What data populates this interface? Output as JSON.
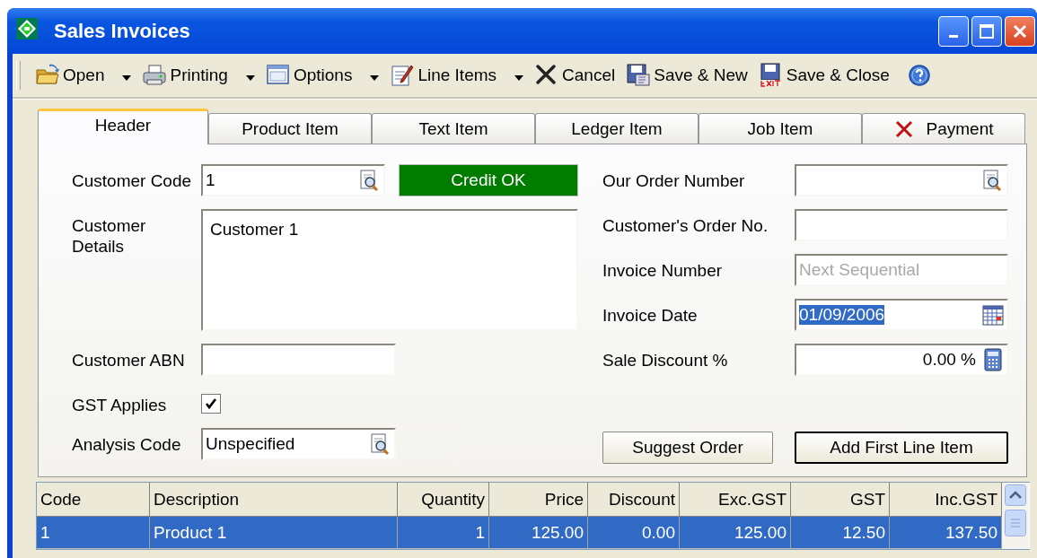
{
  "window": {
    "title": "Sales Invoices"
  },
  "toolbar": [
    {
      "label": "Open",
      "kind": "dropdown"
    },
    {
      "label": "Printing",
      "kind": "dropdown"
    },
    {
      "label": "Options",
      "kind": "dropdown"
    },
    {
      "label": "Line Items",
      "kind": "dropdown"
    },
    {
      "label": "Cancel",
      "kind": "button"
    },
    {
      "label": "Save & New",
      "kind": "button"
    },
    {
      "label": "Save & Close",
      "kind": "button"
    }
  ],
  "tabs": [
    {
      "label": "Header",
      "selected": true
    },
    {
      "label": "Product Item",
      "selected": false
    },
    {
      "label": "Text Item",
      "selected": false
    },
    {
      "label": "Ledger Item",
      "selected": false
    },
    {
      "label": "Job Item",
      "selected": false
    },
    {
      "label": "Payment",
      "selected": false
    }
  ],
  "credit_status": {
    "text": "Credit OK",
    "ok": true
  },
  "left_fields": [
    {
      "label": "Customer Code",
      "kind": "lookup",
      "value": "1"
    },
    {
      "label": "Customer Details",
      "kind": "textarea",
      "value": "Customer 1"
    },
    {
      "label": "Customer ABN",
      "kind": "text"
    },
    {
      "label": "GST Applies",
      "kind": "checkbox",
      "checked": true
    },
    {
      "label": "Analysis Code",
      "kind": "lookup",
      "value": "Unspecified"
    }
  ],
  "right_fields": [
    {
      "label": "Our Order Number",
      "kind": "lookup"
    },
    {
      "label": "Customer's Order No.",
      "kind": "text"
    },
    {
      "label": "Invoice Number",
      "kind": "text",
      "placeholder": "Next Sequential"
    },
    {
      "label": "Invoice Date",
      "kind": "date",
      "value": "01/09/2006",
      "highlighted": true
    },
    {
      "label": "Sale Discount %",
      "kind": "number",
      "value": "0.00 %"
    }
  ],
  "buttons": [
    {
      "label": "Suggest Order",
      "default": false
    },
    {
      "label": "Add First Line Item",
      "default": true
    }
  ],
  "table": {
    "columns": [
      "Code",
      "Description",
      "Quantity",
      "Price",
      "Discount",
      "Exc.GST",
      "GST",
      "Inc.GST"
    ],
    "rows": [
      {
        "selected": true,
        "cells": [
          "1",
          "Product 1",
          "1",
          "125.00",
          "0.00",
          "125.00",
          "12.50",
          "137.50"
        ]
      }
    ]
  }
}
